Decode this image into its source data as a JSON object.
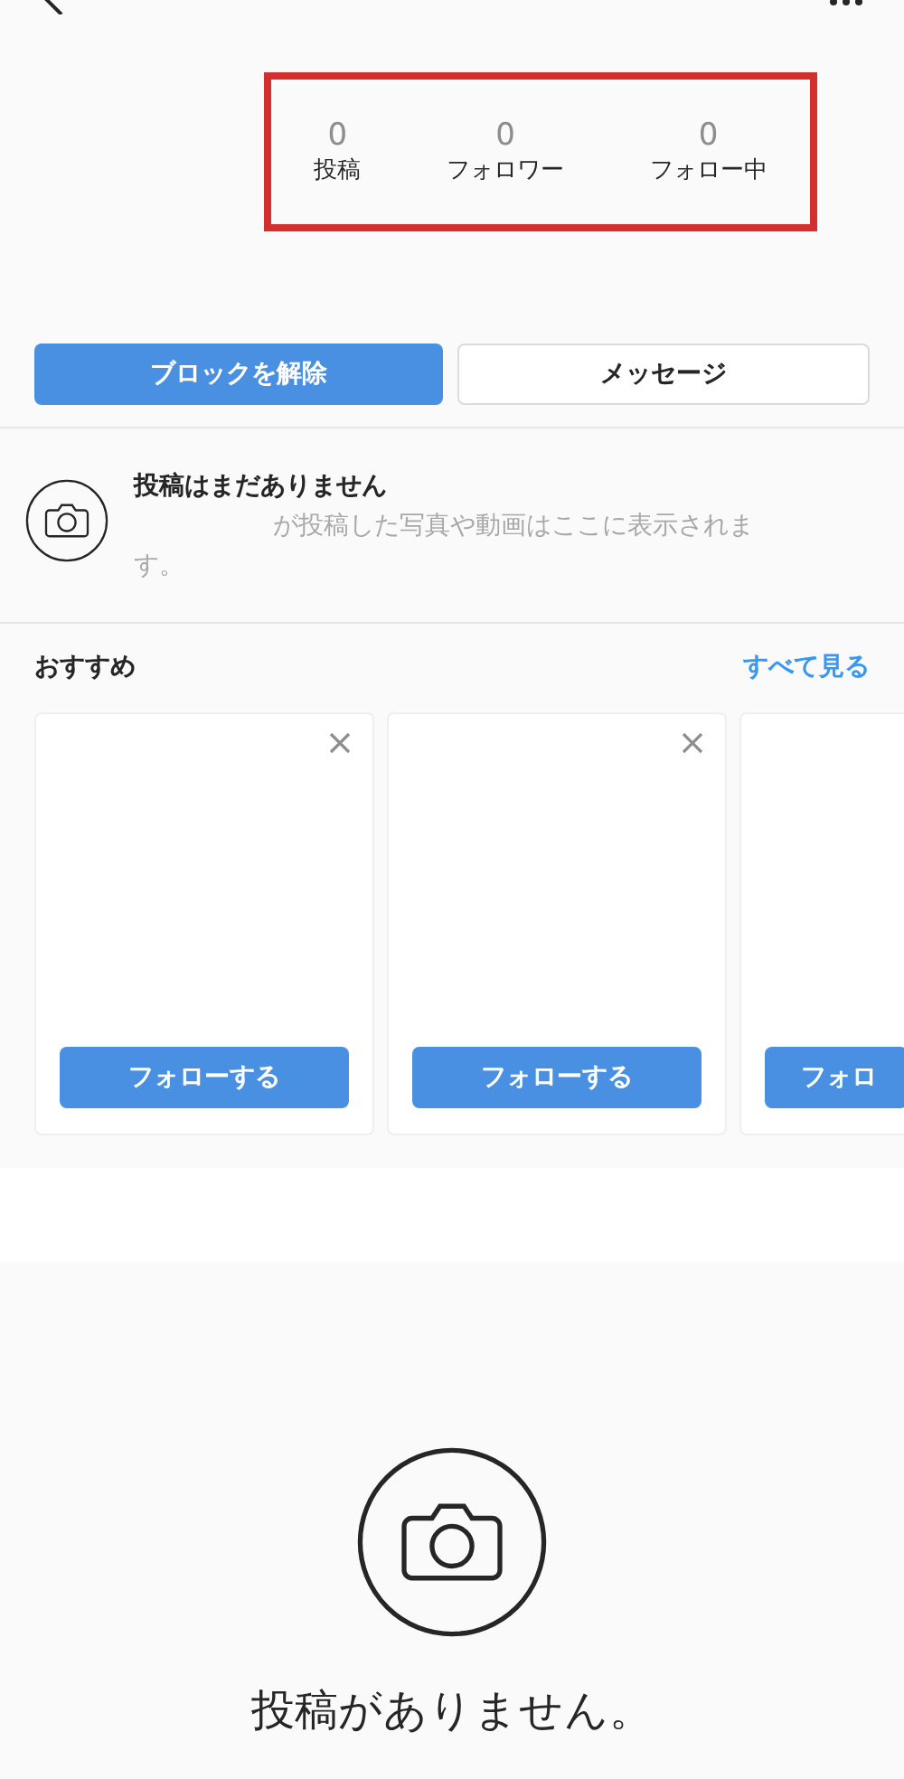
{
  "stats": [
    {
      "count": "0",
      "label": "投稿"
    },
    {
      "count": "0",
      "label": "フォロワー"
    },
    {
      "count": "0",
      "label": "フォロー中"
    }
  ],
  "actions": {
    "unblock": "ブロックを解除",
    "message": "メッセージ"
  },
  "empty_notice": {
    "title": "投稿はまだありません",
    "description": "が投稿した写真や動画はここに表示されます。"
  },
  "suggestions": {
    "title": "おすすめ",
    "see_all": "すべて見る",
    "cards": [
      {
        "button": "フォローする",
        "closable": true
      },
      {
        "button": "フォローする",
        "closable": true
      },
      {
        "button": "フォロ",
        "closable": false
      }
    ]
  },
  "empty_state": {
    "message": "投稿がありません。"
  }
}
